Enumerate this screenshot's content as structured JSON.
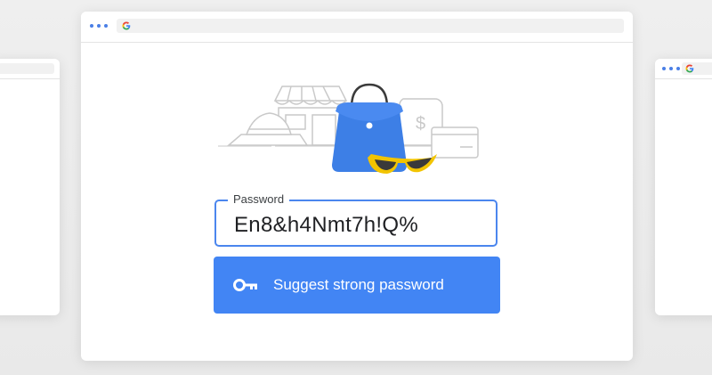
{
  "colors": {
    "accent": "#4285f4",
    "field_border": "#4b86ee",
    "bag": "#3d7fe6",
    "sunglasses_frame": "#f2c400",
    "line_art": "#c9c9c9"
  },
  "icons": {
    "google_logo": "google-g-icon",
    "key": "key-icon",
    "menu_dots": "three-dots-icon"
  },
  "password_field": {
    "label": "Password",
    "value": "En8&h4Nmt7h!Q%"
  },
  "suggest_button": {
    "label": "Suggest strong password"
  }
}
